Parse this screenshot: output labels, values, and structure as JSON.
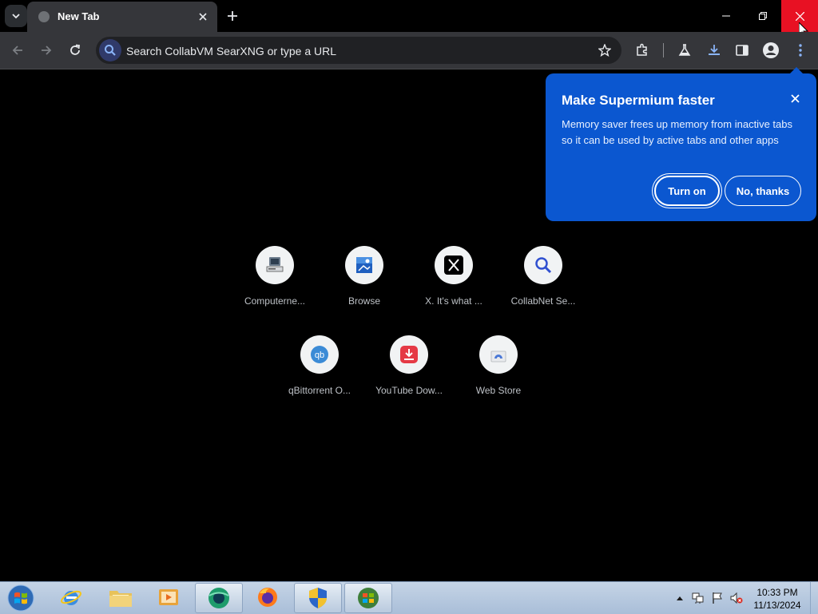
{
  "browser": {
    "tab_title": "New Tab",
    "omnibox_placeholder": "Search CollabVM SearXNG or type a URL"
  },
  "popup": {
    "title": "Make Supermium faster",
    "body": "Memory saver frees up memory from inactive tabs so it can be used by active tabs and other apps",
    "turn_on": "Turn on",
    "no_thanks": "No, thanks",
    "bg_color": "#0b57d0"
  },
  "shortcuts": [
    {
      "label": "Computerne...",
      "icon": "computer-icon"
    },
    {
      "label": "Browse",
      "icon": "browse-icon"
    },
    {
      "label": "X. It's what ...",
      "icon": "x-logo-icon"
    },
    {
      "label": "CollabNet Se...",
      "icon": "search-icon"
    },
    {
      "label": "qBittorrent O...",
      "icon": "qbittorrent-icon"
    },
    {
      "label": "YouTube Dow...",
      "icon": "download-icon"
    },
    {
      "label": "Web Store",
      "icon": "web-store-icon"
    }
  ],
  "taskbar": {
    "time": "10:33 PM",
    "date": "11/13/2024",
    "items": [
      "internet-explorer",
      "file-explorer",
      "media-player",
      "browser",
      "firefox",
      "security",
      "windows-update"
    ]
  }
}
